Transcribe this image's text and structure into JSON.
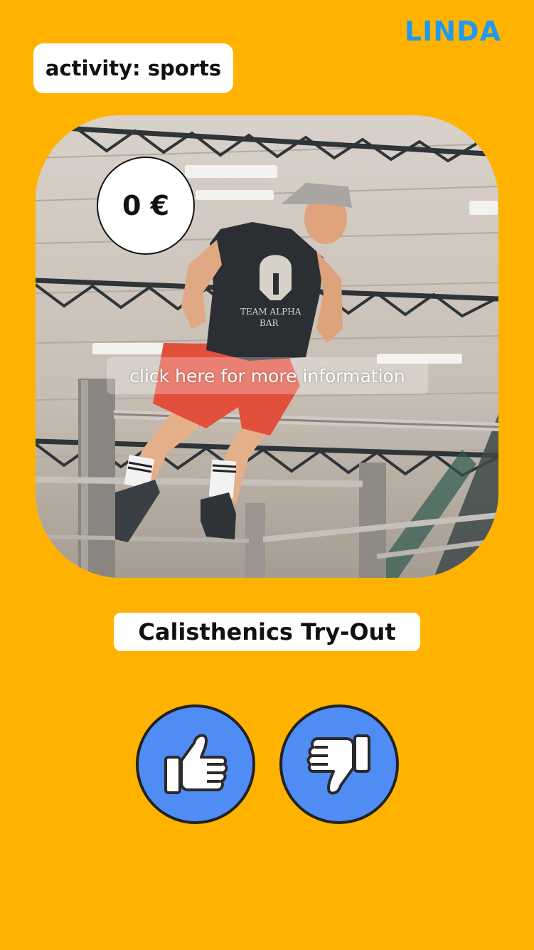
{
  "app": {
    "logo_text": "LINDA",
    "accent_color": "#1E9BF0",
    "background_color": "#FFB300"
  },
  "activity": {
    "category_label": "activity: sports",
    "price_label": "0 €",
    "info_link_text": "click here for more information",
    "title": "Calisthenics Try-Out",
    "image_icon": "calisthenics-photo"
  },
  "actions": {
    "like_icon": "thumbs-up-icon",
    "dislike_icon": "thumbs-down-icon",
    "button_color": "#4F8DF5"
  }
}
